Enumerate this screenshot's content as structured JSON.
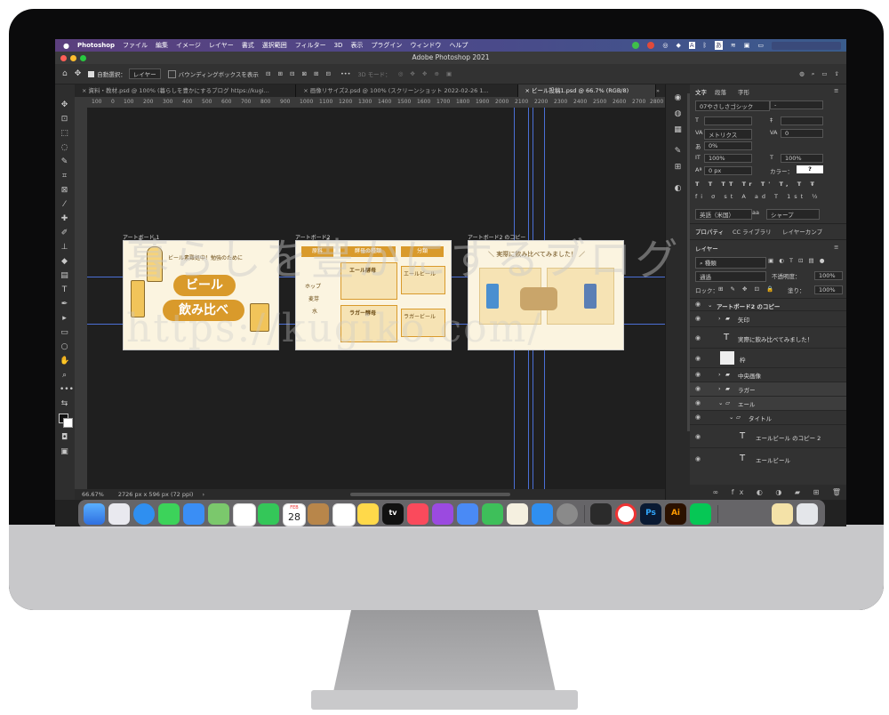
{
  "menubar": {
    "app_name": "Photoshop",
    "items": [
      "ファイル",
      "編集",
      "イメージ",
      "レイヤー",
      "書式",
      "選択範囲",
      "フィルター",
      "3D",
      "表示",
      "プラグイン",
      "ウィンドウ",
      "ヘルプ"
    ]
  },
  "window": {
    "title": "Adobe Photoshop 2021"
  },
  "options": {
    "auto_select_label": "自動選択：",
    "auto_select_value": "レイヤー",
    "bounding_box_label": "バウンディングボックスを表示",
    "mode_3d_label": "3D モード："
  },
  "tabs": [
    {
      "label": "資料・教材.psd @ 100% (暮らしを豊かにするブログ https://kugi..."
    },
    {
      "label": "画像リサイズ2.psd @ 100% (スクリーンショット 2022-02-26 1..."
    },
    {
      "label": "ビール投稿1.psd @ 66.7% (RGB/8)"
    }
  ],
  "ruler_ticks": [
    "100",
    "0",
    "100",
    "200",
    "300",
    "400",
    "500",
    "600",
    "700",
    "800",
    "900",
    "1000",
    "1100",
    "1200",
    "1300",
    "1400",
    "1500",
    "1600",
    "1700",
    "1800",
    "1900",
    "2000",
    "2100",
    "2200",
    "2300",
    "2400",
    "2500",
    "2600",
    "2700",
    "2800"
  ],
  "artboards": {
    "ab1": {
      "label": "アートボード 1",
      "subtitle": "ビール素難処中！勉強のために",
      "title_line1": "ビール",
      "title_line2": "飲み比べ"
    },
    "ab2": {
      "label": "アートボード2",
      "col1_header": "原料",
      "col2_header": "酵母の種類",
      "col3_header": "分類",
      "ingredients": [
        "ホップ",
        "麦芽",
        "水"
      ],
      "yeast_top": "エール酵母",
      "yeast_bottom": "ラガー酵母",
      "class_top": "エールビール",
      "class_bottom": "ラガービール"
    },
    "ab3": {
      "label": "アートボード2 のコピー",
      "heading": "＼ 実際に飲み比べてみました！ ／"
    }
  },
  "status": {
    "zoom": "66.67%",
    "doc_info": "2726 px x 596 px (72 ppi)"
  },
  "char_panel": {
    "tabs": [
      "文字",
      "段落",
      "字形"
    ],
    "font_family": "07やさしさゴシック",
    "font_style": "-",
    "tracking_label": "メトリクス",
    "tracking_value": "0",
    "percent": "0%",
    "vscale": "100%",
    "hscale": "100%",
    "baseline": "0 px",
    "color_label": "カラー：",
    "color_value": "?",
    "language": "英語（米国）",
    "aa": "シャープ"
  },
  "props_tabs": [
    "プロパティ",
    "CC ライブラリ",
    "レイヤーカンプ"
  ],
  "layers_panel": {
    "tab": "レイヤー",
    "kind_label": "種類",
    "blend": "通過",
    "opacity_label": "不透明度：",
    "opacity": "100%",
    "lock_label": "ロック：",
    "fill_label": "塗り：",
    "fill": "100%",
    "layers": [
      {
        "name": "アートボード2 のコピー"
      },
      {
        "name": "矢印"
      },
      {
        "name": "実際に飲み比べてみました！"
      },
      {
        "name": "枠"
      },
      {
        "name": "中央画像"
      },
      {
        "name": "ラガー"
      },
      {
        "name": "エール"
      },
      {
        "name": "タイトル"
      },
      {
        "name": "エールビール のコピー 2"
      },
      {
        "name": "エールビール"
      }
    ]
  },
  "watermark": {
    "line1": "暮らしを豊かにするブログ",
    "line2": "https://kugiko.com/"
  },
  "dock": {
    "calendar_day": "28",
    "calendar_month": "FEB",
    "tv_label": "tv",
    "ps_label": "Ps",
    "ai_label": "Ai"
  },
  "colors": {
    "brand_gold": "#d99a2b",
    "accent_blue": "#4b6fd6",
    "panel_bg": "#323232"
  }
}
